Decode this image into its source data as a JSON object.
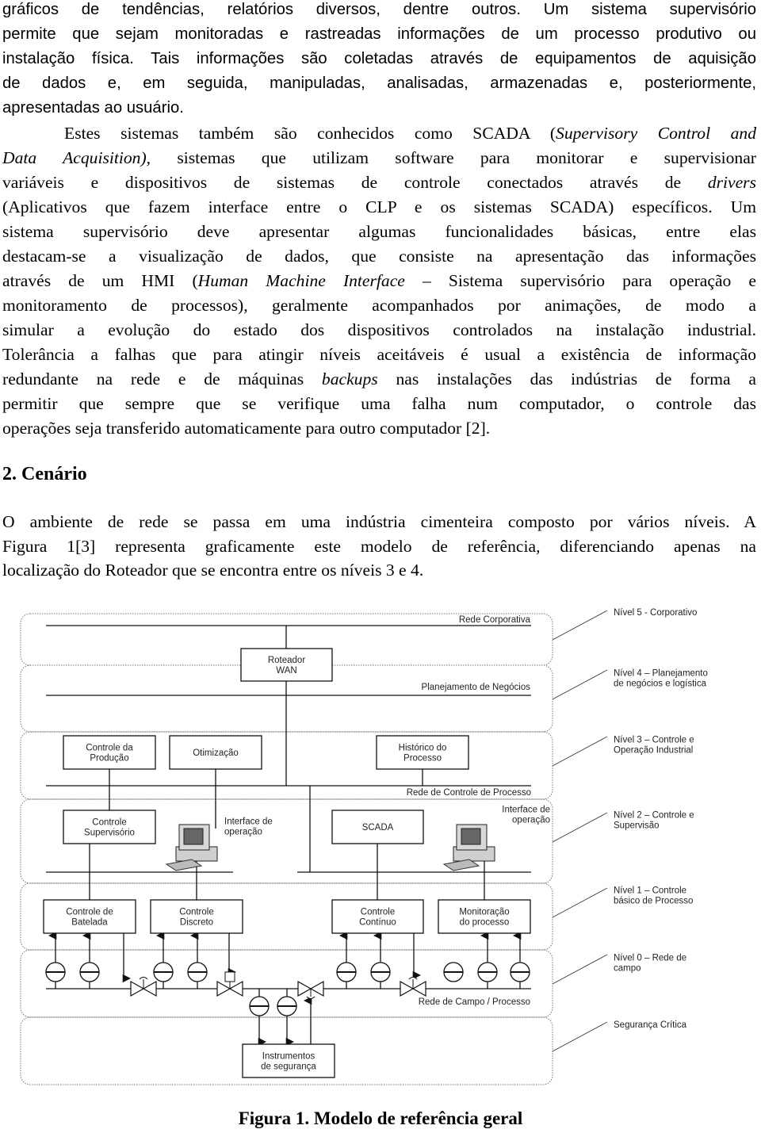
{
  "body_lines": [
    {
      "font": "sans",
      "segs": [
        {
          "t": "gráficos de tendências, relatórios diversos, dentre outros. Um sistema supervisório"
        }
      ]
    },
    {
      "font": "sans",
      "segs": [
        {
          "t": "permite que sejam monitoradas e rastreadas informações de um processo produtivo ou"
        }
      ]
    },
    {
      "font": "sans",
      "segs": [
        {
          "t": "instalação física. Tais informações são coletadas através de equipamentos de aquisição"
        }
      ]
    },
    {
      "font": "sans",
      "segs": [
        {
          "t": "de dados e, em seguida, manipuladas, analisadas, armazenadas e, posteriormente,"
        }
      ]
    },
    {
      "font": "sans",
      "last": true,
      "segs": [
        {
          "t": "apresentadas ao usuário."
        }
      ]
    },
    {
      "font": "serif",
      "indent": true,
      "segs": [
        {
          "t": "Estes sistemas também são conhecidos como SCADA ("
        },
        {
          "t": "Supervisory Control and",
          "i": true
        }
      ]
    },
    {
      "font": "serif",
      "segs": [
        {
          "t": "Data Acquisition),",
          "i": true
        },
        {
          "t": " sistemas que utilizam software para monitorar e supervisionar"
        }
      ]
    },
    {
      "font": "serif",
      "segs": [
        {
          "t": "variáveis e dispositivos de sistemas de controle conectados através de "
        },
        {
          "t": "drivers",
          "i": true
        }
      ]
    },
    {
      "font": "serif",
      "segs": [
        {
          "t": "(Aplicativos que fazem interface entre o CLP e os sistemas SCADA) específicos. Um"
        }
      ]
    },
    {
      "font": "serif",
      "segs": [
        {
          "t": "sistema supervisório deve apresentar algumas funcionalidades básicas, entre elas"
        }
      ]
    },
    {
      "font": "serif",
      "segs": [
        {
          "t": "destacam-se a visualização de dados, que consiste na apresentação das informações"
        }
      ]
    },
    {
      "font": "serif",
      "segs": [
        {
          "t": "através de um HMI ("
        },
        {
          "t": "Human Machine Interface",
          "i": true
        },
        {
          "t": " – Sistema supervisório para operação e"
        }
      ]
    },
    {
      "font": "serif",
      "segs": [
        {
          "t": "monitoramento de processos), geralmente acompanhados por animações, de modo a"
        }
      ]
    },
    {
      "font": "serif",
      "segs": [
        {
          "t": "simular a evolução do estado dos dispositivos controlados na instalação industrial."
        }
      ]
    },
    {
      "font": "serif",
      "segs": [
        {
          "t": "Tolerância a falhas que para atingir níveis aceitáveis é usual a existência de informação"
        }
      ]
    },
    {
      "font": "serif",
      "segs": [
        {
          "t": "redundante na rede e de máquinas "
        },
        {
          "t": "backups",
          "i": true
        },
        {
          "t": " nas instalações das indústrias de forma a"
        }
      ]
    },
    {
      "font": "serif",
      "segs": [
        {
          "t": "permitir que sempre que se verifique uma falha num computador, o controle das"
        }
      ]
    },
    {
      "font": "serif",
      "last": true,
      "segs": [
        {
          "t": "operações seja transferido automaticamente para outro computador [2]."
        }
      ]
    }
  ],
  "section_heading": "2.  Cenário",
  "section_lines": [
    {
      "font": "serif",
      "segs": [
        {
          "t": "O ambiente de rede se passa em uma indústria cimenteira composto por vários níveis. A"
        }
      ]
    },
    {
      "font": "serif",
      "segs": [
        {
          "t": "Figura 1[3] representa graficamente este modelo de referência, diferenciando apenas na"
        }
      ]
    },
    {
      "font": "serif",
      "last": true,
      "segs": [
        {
          "t": "localização do Roteador que se encontra entre os níveis 3 e 4."
        }
      ]
    }
  ],
  "figure": {
    "networks": {
      "corporativa": "Rede Corporativa",
      "planejamento": "Planejamento de Negócios",
      "controle_processo": "Rede de Controle de Processo",
      "campo": "Rede de Campo / Processo"
    },
    "boxes": {
      "roteador": [
        "Roteador",
        "WAN"
      ],
      "controle_producao": [
        "Controle da",
        "Produção"
      ],
      "otimizacao": [
        "Otimização"
      ],
      "historico": [
        "Histórico do",
        "Processo"
      ],
      "controle_supervisorio": [
        "Controle",
        "Supervisório"
      ],
      "scada": [
        "SCADA"
      ],
      "batelada": [
        "Controle de",
        "Batelada"
      ],
      "discreto": [
        "Controle",
        "Discreto"
      ],
      "continuo": [
        "Controle",
        "Contínuo"
      ],
      "monitoracao": [
        "Monitoração",
        "do processo"
      ],
      "instrumentos": [
        "Instrumentos",
        "de segurança"
      ]
    },
    "interface_1": [
      "Interface de",
      "operação"
    ],
    "interface_2": [
      "Interface de",
      "operação"
    ],
    "levels": [
      [
        "Nível 5 - Corporativo"
      ],
      [
        "Nível 4 – Planejamento",
        "de negócios e logística"
      ],
      [
        "Nível 3 – Controle e",
        "Operação Industrial"
      ],
      [
        "Nível 2 – Controle e",
        "Supervisão"
      ],
      [
        "Nível 1 – Controle",
        "básico de Processo"
      ],
      [
        "Nível 0 – Rede de",
        "campo"
      ],
      [
        "Segurança Crítica"
      ]
    ],
    "caption": "Figura 1. Modelo de referência geral"
  }
}
